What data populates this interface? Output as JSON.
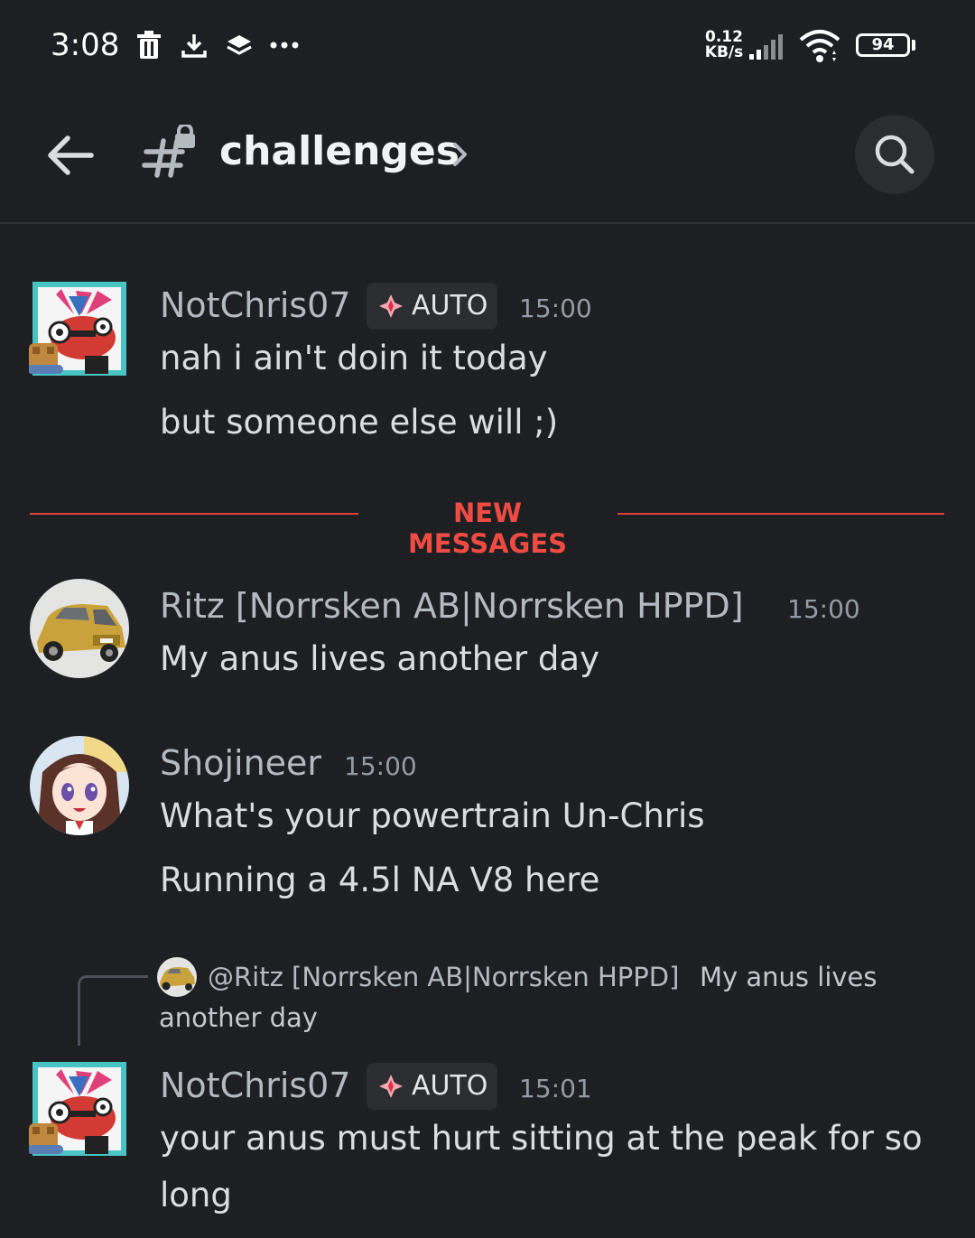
{
  "status_bar": {
    "time": "3:08",
    "icons": [
      "trash-icon",
      "download-icon",
      "layers-icon",
      "more-dots-icon"
    ],
    "net_speed_value": "0.12",
    "net_speed_unit": "KB/s",
    "battery": "94"
  },
  "header": {
    "channel_name": "challenges",
    "icons": [
      "back-arrow-icon",
      "locked-hash-icon",
      "chevron-right-icon",
      "search-icon"
    ]
  },
  "divider": {
    "label": "NEW MESSAGES",
    "color": "#ef4b43"
  },
  "messages": [
    {
      "author": "NotChris07",
      "badge": "AUTO",
      "time": "15:00",
      "lines": [
        "nah i ain't doin it today",
        "but someone else will ;)"
      ]
    },
    {
      "author": "Ritz [Norrsken AB|Norrsken HPPD]",
      "time": "15:00",
      "lines": [
        "My anus lives another day"
      ]
    },
    {
      "author": "Shojineer",
      "time": "15:00",
      "lines": [
        "What's your powertrain Un-Chris",
        "Running a 4.5l NA V8 here"
      ]
    },
    {
      "reply": {
        "user": "@Ritz [Norrsken AB|Norrsken HPPD]",
        "text_part1": "My anus lives",
        "text_part2": "another day"
      },
      "author": "NotChris07",
      "badge": "AUTO",
      "time": "15:01",
      "lines": [
        "your anus must hurt sitting at the peak for so",
        "long"
      ]
    }
  ]
}
